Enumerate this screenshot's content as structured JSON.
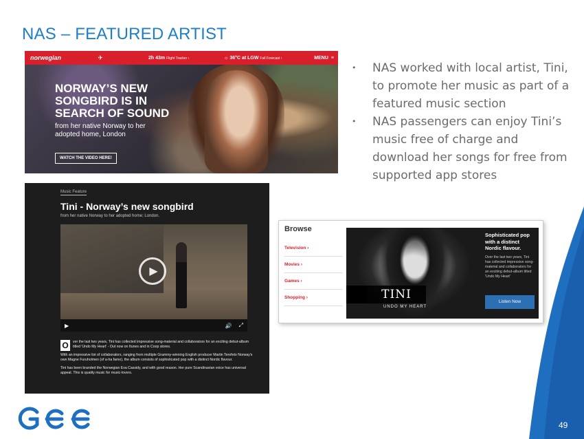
{
  "slide": {
    "title": "NAS – FEATURED ARTIST",
    "page_number": "49",
    "accent_color": "#1f7fc3"
  },
  "bullets": [
    "NAS worked with local artist, Tini, to promote her music as part of a featured music section",
    "NAS passengers can enjoy Tini’s music free of charge and download her songs for free from supported app stores"
  ],
  "banner": {
    "brand": "norwegian",
    "brand_color": "#d8202c",
    "flight_time": "2h 43m",
    "flight_tracker": "Flight Tracker ›",
    "weather": "36°C at LGW",
    "weather_link": "Full Forecast ›",
    "menu": "MENU",
    "headline": "NORWAY’S NEW SONGBIRD IS IN SEARCH OF SOUND",
    "subtitle": "from her native Norway to her adopted home, London",
    "cta": "WATCH THE VIDEO HERE!"
  },
  "video_article": {
    "tag": "Music Feature",
    "title": "Tini - Norway’s new songbird",
    "subtitle": "from her native Norway to her adopted home; London.",
    "drop_cap": "O",
    "paragraphs": [
      "ver the last two years, Tini has collected impressive song-material and collaborators for an exciting debut-album titled 'Undo My Heart' - Out now on Itunes and in Coop stores.",
      "With an impressive list of collaborators, ranging from multiple Grammy-winning English producer Martin Terefeto Norway's own Magne Furuholmen (of a-ha fame), the album consists of sophisticated pop with a distinct Nordic flavour.",
      "Tini has been branded the Norwegian Eva Cassidy, and with good reason. Her pure Scandinavian voice has universal appeal. This is quality music for music-lovers."
    ]
  },
  "browse": {
    "heading": "Browse",
    "items": [
      "Television ›",
      "Movies ›",
      "Games ›",
      "Shopping ›"
    ],
    "artist_logo": "TINI",
    "album": "UNDO MY HEART",
    "promo_title": "Sophisticated pop with a distinct Nordic flavour.",
    "promo_text": "Over the last two years, Tini has collected impressive song-material and collaborators for an exciting debut-album titled 'Undo My Heart'",
    "promo_button": "Listen Now"
  }
}
